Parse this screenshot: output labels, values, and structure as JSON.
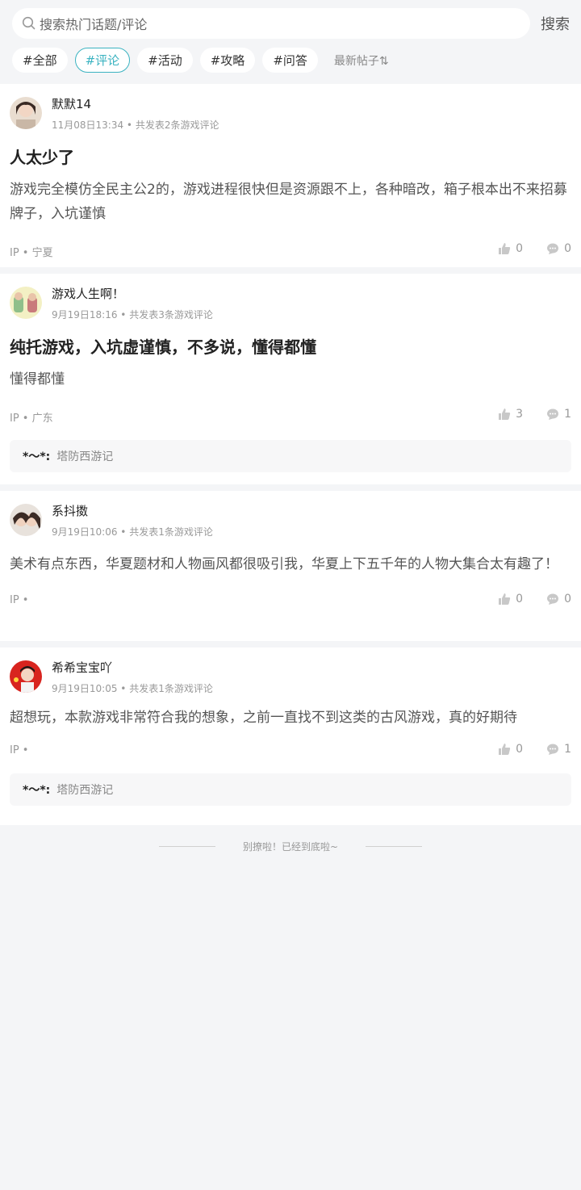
{
  "search": {
    "placeholder": "搜索热门话题/评论",
    "button": "搜索"
  },
  "tabs": [
    {
      "label": "#全部",
      "active": false
    },
    {
      "label": "#评论",
      "active": true
    },
    {
      "label": "#活动",
      "active": false
    },
    {
      "label": "#攻略",
      "active": false
    },
    {
      "label": "#问答",
      "active": false
    }
  ],
  "sort_label": "最新帖子⇅",
  "posts": [
    {
      "username": "默默14",
      "meta": "11月08日13:34 • 共发表2条游戏评论",
      "title": "人太少了",
      "body": "游戏完全模仿全民主公2的，游戏进程很快但是资源跟不上，各种暗改，箱子根本出不来招募牌子，入坑谨慎",
      "ip": "IP • 宁夏",
      "likes": "0",
      "comments": "0"
    },
    {
      "username": "游戏人生啊！",
      "meta": "9月19日18:16 • 共发表3条游戏评论",
      "title": "纯托游戏，入坑虚谨慎，不多说，懂得都懂",
      "body": "懂得都懂",
      "ip": "IP • 广东",
      "likes": "3",
      "comments": "1",
      "game_symbol": "*～*:",
      "game_name": "塔防西游记"
    },
    {
      "username": "系抖擞",
      "meta": "9月19日10:06 • 共发表1条游戏评论",
      "body": "美术有点东西，华夏题材和人物画风都很吸引我，华夏上下五千年的人物大集合太有趣了！",
      "ip": "IP •",
      "likes": "0",
      "comments": "0"
    },
    {
      "username": "希希宝宝吖",
      "meta": "9月19日10:05 • 共发表1条游戏评论",
      "body": "超想玩，本款游戏非常符合我的想象，之前一直找不到这类的古风游戏，真的好期待",
      "ip": "IP •",
      "likes": "0",
      "comments": "1",
      "game_symbol": "*～*:",
      "game_name": "塔防西游记"
    }
  ],
  "end_text": "别撩啦！已经到底啦~",
  "colors": {
    "accent": "#3bb3c1",
    "background": "#f4f5f7"
  }
}
